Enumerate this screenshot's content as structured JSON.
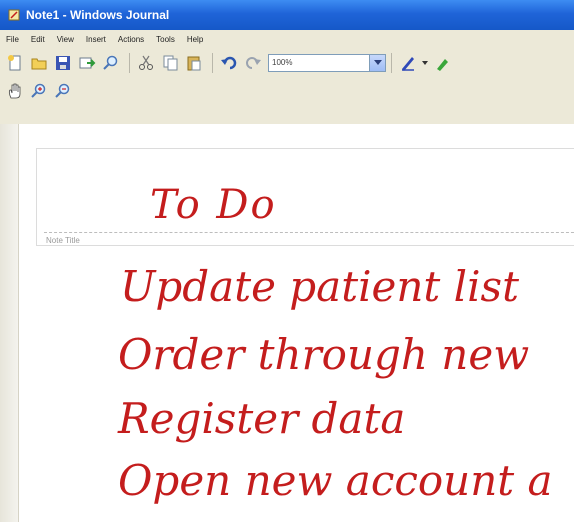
{
  "window": {
    "title": "Note1 - Windows Journal"
  },
  "menu": [
    "File",
    "Edit",
    "View",
    "Insert",
    "Actions",
    "Tools",
    "Help"
  ],
  "toolbar": {
    "row1": [
      "new-note-icon",
      "open-folder-icon",
      "save-icon",
      "send-icon",
      "find-icon",
      "cut-icon",
      "copy-icon",
      "paste-icon",
      "undo-icon",
      "redo-icon"
    ],
    "zoom_value": "100%",
    "row2": [
      "hand-tool-icon",
      "zoom-in-icon",
      "zoom-out-icon"
    ]
  },
  "note": {
    "title_caption": "Note Title",
    "title_ink": "To Do",
    "lines": [
      "Update patient list",
      "Order through new",
      "Register data",
      "Open new account a"
    ]
  },
  "colors": {
    "ink": "#c41d1d",
    "titlebar": "#1f64d8",
    "chrome": "#ece9d8"
  }
}
